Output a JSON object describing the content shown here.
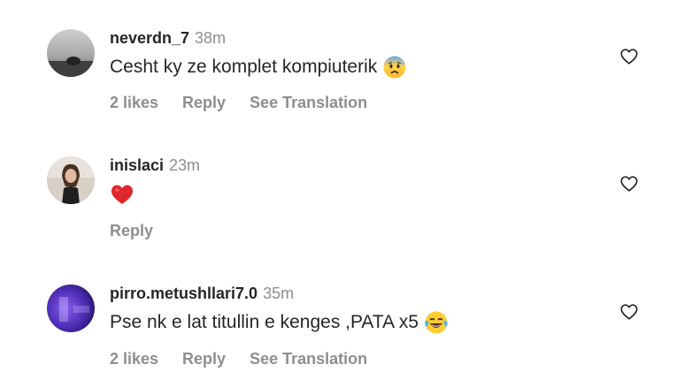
{
  "comments": [
    {
      "username": "neverdn_7",
      "time": "38m",
      "text": "Cesht ky ze komplet kompiuterik",
      "emoji": "anxious-face-with-sweat",
      "likes": "2 likes",
      "reply": "Reply",
      "translation": "See Translation"
    },
    {
      "username": "inislaci",
      "time": "23m",
      "text": "",
      "emoji": "red-heart",
      "reply": "Reply"
    },
    {
      "username": "pirro.metushllari7.0",
      "time": "35m",
      "text": "Pse nk e lat titullin e kenges ,PATA x5",
      "emoji": "face-with-tears-of-joy",
      "likes": "2 likes",
      "reply": "Reply",
      "translation": "See Translation"
    }
  ],
  "colors": {
    "primary_text": "#262626",
    "secondary_text": "#8e8e8e",
    "background": "#ffffff"
  }
}
